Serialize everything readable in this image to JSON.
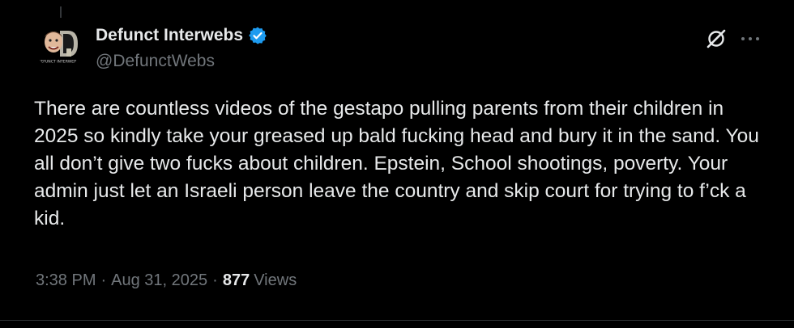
{
  "post": {
    "author": {
      "display_name": "Defunct Interwebs",
      "handle": "@DefunctWebs",
      "verified": true,
      "avatar_text": "DEFUNCT INTERWEBS"
    },
    "text": "There are countless videos of the gestapo pulling parents from their children in 2025 so kindly take your greased up bald fucking head and bury it in the sand. You all don’t give two fucks about children. Epstein, School shootings, poverty. Your admin just let an Israeli person leave the country and skip court for trying to f’ck a kid.",
    "time": "3:38 PM",
    "date": "Aug 31, 2025",
    "separator": "·",
    "views_count": "877",
    "views_label": "Views"
  },
  "icons": {
    "verified": "verified-badge-icon",
    "grok": "grok-icon",
    "more": "more-options-icon"
  },
  "colors": {
    "background": "#000000",
    "text_primary": "#e7e9ea",
    "text_secondary": "#71767b",
    "verified_blue": "#1d9bf0",
    "divider": "#2f3336"
  }
}
